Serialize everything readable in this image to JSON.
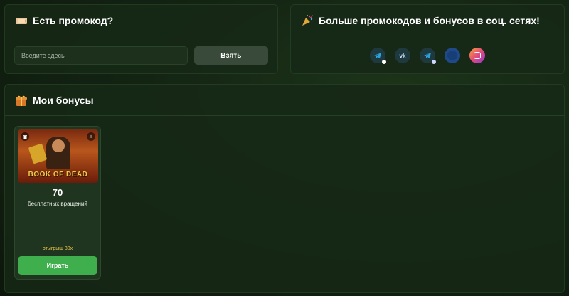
{
  "promo": {
    "title": "Есть промокод?",
    "icon": "ticket-icon",
    "input_placeholder": "Введите здесь",
    "button_label": "Взять"
  },
  "socials": {
    "title": "Больше промокодов и бонусов в соц. сетях!",
    "icon": "party-popper-icon",
    "items": [
      {
        "name": "telegram-chat",
        "icon": "telegram-icon",
        "color": "#2aa3e0"
      },
      {
        "name": "vk",
        "icon": "vk-icon",
        "color": "#5b8fd6"
      },
      {
        "name": "telegram-channel",
        "icon": "telegram-icon",
        "color": "#2aa3e0"
      },
      {
        "name": "unknown",
        "icon": "dark-blue-circle-icon",
        "color": "#1f4a8a"
      },
      {
        "name": "instagram",
        "icon": "instagram-icon",
        "color": "#e24a7a"
      }
    ]
  },
  "bonuses": {
    "title": "Мои бонусы",
    "icon": "gift-icon",
    "cards": [
      {
        "game": "BOOK OF DEAD",
        "amount": "70",
        "description": "бесплатных вращений",
        "wager": "отыгрыш 30х",
        "play_label": "Играть"
      }
    ]
  },
  "colors": {
    "accent_green": "#3fae4d",
    "wager_yellow": "#e8c54a",
    "panel_bg": "#162816"
  }
}
